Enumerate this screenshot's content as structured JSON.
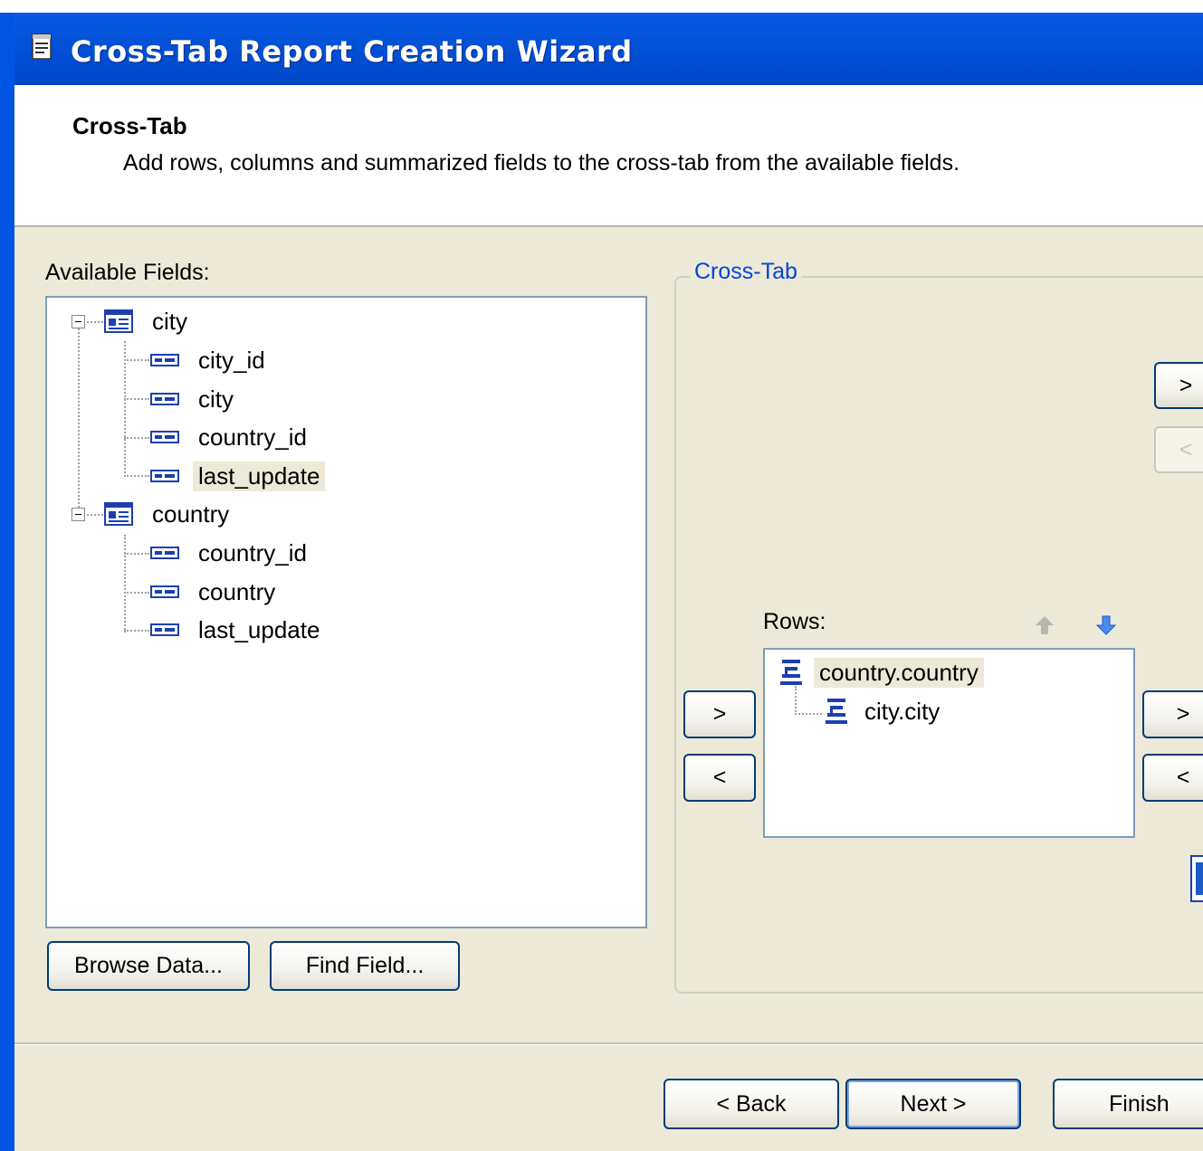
{
  "window": {
    "title": "Cross-Tab Report Creation Wizard"
  },
  "header": {
    "title": "Cross-Tab",
    "description": "Add rows, columns and summarized fields to the cross-tab from the available fields."
  },
  "available_fields": {
    "label": "Available Fields:",
    "tables": [
      {
        "name": "city",
        "fields": [
          "city_id",
          "city",
          "country_id",
          "last_update"
        ]
      },
      {
        "name": "country",
        "fields": [
          "country_id",
          "country",
          "last_update"
        ]
      }
    ],
    "selected": "last_update"
  },
  "buttons": {
    "browse_data": "Browse Data...",
    "find_field": "Find Field...",
    "arrow_right": ">",
    "arrow_left": "<",
    "back": "< Back",
    "next": "Next >",
    "finish": "Finish"
  },
  "crosstab": {
    "group_label": "Cross-Tab",
    "rows_label": "Rows:",
    "rows": [
      "country.country",
      "city.city"
    ]
  },
  "colors": {
    "titlebar": "#0054e3",
    "dialog_bg": "#ece9d8",
    "group_label": "#0046d5"
  }
}
